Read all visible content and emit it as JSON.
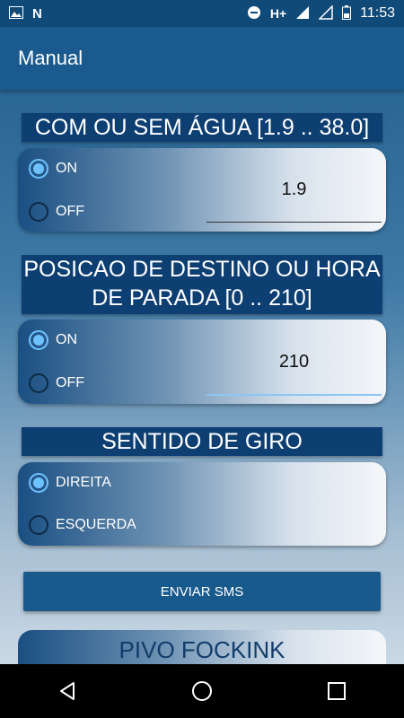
{
  "status_bar": {
    "time": "11:53",
    "network": "H+",
    "icons": [
      "image-icon",
      "n-notification-icon",
      "dnd-icon",
      "signal-icon",
      "signal-icon",
      "battery-icon"
    ]
  },
  "app_bar": {
    "title": "Manual"
  },
  "section_water": {
    "header": "COM OU SEM ÁGUA [1.9 .. 38.0]",
    "options": [
      {
        "label": "ON",
        "selected": true
      },
      {
        "label": "OFF",
        "selected": false
      }
    ],
    "value": "1.9"
  },
  "section_position": {
    "header_line1": "POSICAO DE DESTINO OU HORA",
    "header_line2": "DE PARADA [0 .. 210]",
    "options": [
      {
        "label": "ON",
        "selected": true
      },
      {
        "label": "OFF",
        "selected": false
      }
    ],
    "value": "210"
  },
  "section_direction": {
    "header": "SENTIDO DE GIRO",
    "options": [
      {
        "label": "DIREITA",
        "selected": true
      },
      {
        "label": "ESQUERDA",
        "selected": false
      }
    ]
  },
  "send_button": {
    "label": "ENVIAR SMS"
  },
  "brand": {
    "text": "PIVO FOCKINK"
  },
  "colors": {
    "app_bar": "#1a5a8e",
    "header": "#0e3f72",
    "accent": "#6ec3ff"
  }
}
